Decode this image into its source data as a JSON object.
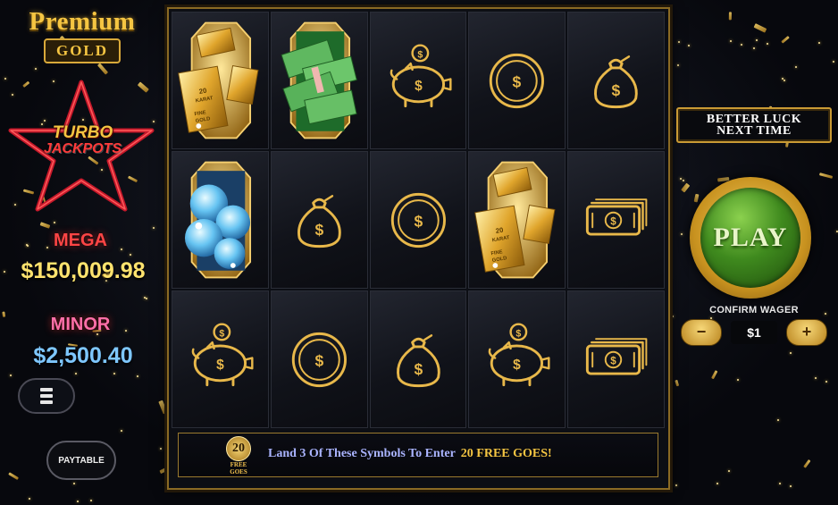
{
  "brand": {
    "title_line1": "Premium",
    "title_line2": "GOLD"
  },
  "turbo": {
    "line1": "TURBO",
    "line2": "JACKPOTS"
  },
  "jackpots": {
    "mega": {
      "label": "MEGA",
      "value": "$150,009.98"
    },
    "minor": {
      "label": "MINOR",
      "value": "$2,500.40"
    }
  },
  "menu": {
    "icon": "hamburger-menu-icon"
  },
  "paytable": {
    "label": "PAYTABLE"
  },
  "grid": {
    "rows": 3,
    "cols": 5,
    "symbols": [
      [
        "gold-bars",
        "cash-stack",
        "piggy-bank",
        "coin",
        "money-bag"
      ],
      [
        "diamonds",
        "money-bag",
        "coin",
        "gold-bars",
        "banknotes"
      ],
      [
        "piggy-bank",
        "coin",
        "money-bag",
        "piggy-bank",
        "banknotes"
      ]
    ],
    "gold_bar_text": {
      "karat": "20",
      "karat_word": "KARAT",
      "fine": "FINE",
      "gold": "GOLD"
    }
  },
  "banner": {
    "badge_number": "20",
    "badge_text_line1": "FREE",
    "badge_text_line2": "GOES",
    "text": "Land 3 Of These Symbols To Enter",
    "highlight": "20 FREE GOES!"
  },
  "message": {
    "line1": "BETTER LUCK",
    "line2": "NEXT TIME"
  },
  "play": {
    "label": "PLAY"
  },
  "wager": {
    "title": "CONFIRM WAGER",
    "value": "$1",
    "minus": "−",
    "plus": "+"
  },
  "colors": {
    "gold": "#f5c542",
    "frame": "#8a6a24",
    "play_green": "#3f8a1e",
    "mega_red": "#ff4545",
    "minor_blue": "#7ec7ff"
  }
}
